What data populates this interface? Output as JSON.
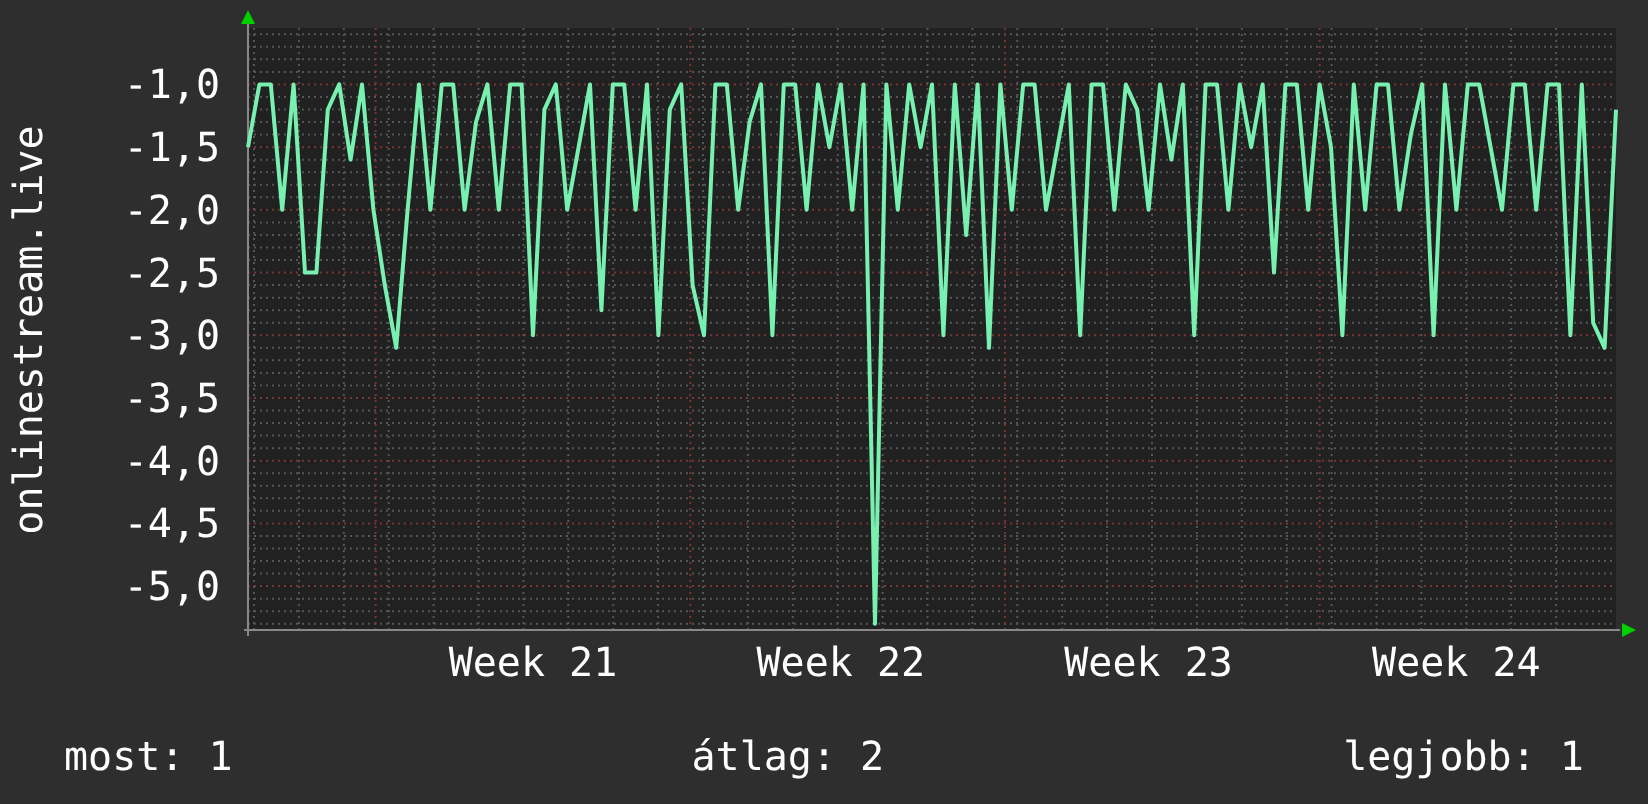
{
  "chart": {
    "chart_data": {
      "type": "line",
      "ylabel": "onlinestream.live",
      "grid": true,
      "ylim": [
        -5.35,
        -0.55
      ],
      "categories": [
        null,
        null,
        null,
        null,
        null,
        null,
        null,
        null,
        null,
        null,
        null,
        null,
        null,
        null,
        null,
        null,
        null,
        null,
        null,
        null,
        null,
        null,
        null,
        null,
        null,
        "Week 21",
        null,
        null,
        null,
        null,
        null,
        null,
        null,
        null,
        null,
        null,
        null,
        null,
        null,
        null,
        null,
        null,
        null,
        null,
        null,
        null,
        null,
        null,
        null,
        null,
        null,
        null,
        "Week 22",
        null,
        null,
        null,
        null,
        null,
        null,
        null,
        null,
        null,
        null,
        null,
        null,
        null,
        null,
        null,
        null,
        null,
        null,
        null,
        null,
        null,
        null,
        null,
        null,
        null,
        null,
        "Week 23",
        null,
        null,
        null,
        null,
        null,
        null,
        null,
        null,
        null,
        null,
        null,
        null,
        null,
        null,
        null,
        null,
        null,
        null,
        null,
        null,
        null,
        null,
        null,
        null,
        null,
        null,
        "Week 24",
        null,
        null,
        null,
        null,
        null,
        null,
        null,
        null,
        null,
        null,
        null,
        null,
        null,
        null
      ],
      "yticks": [
        {
          "value": -1,
          "label": "-1,0"
        },
        {
          "value": -1.5,
          "label": "-1,5"
        },
        {
          "value": -2,
          "label": "-2,0"
        },
        {
          "value": -2.5,
          "label": "-2,5"
        },
        {
          "value": -3,
          "label": "-3,0"
        },
        {
          "value": -3.5,
          "label": "-3,5"
        },
        {
          "value": -4,
          "label": "-4,0"
        },
        {
          "value": -4.5,
          "label": "-4,5"
        },
        {
          "value": -5,
          "label": "-5,0"
        }
      ],
      "series": [
        {
          "color": "#77f0b0",
          "values": [
            -1.5,
            -1.0,
            -1.0,
            -2.0,
            -1.0,
            -2.5,
            -2.5,
            -1.2,
            -1.0,
            -1.6,
            -1.0,
            -2.0,
            -2.6,
            -3.1,
            -2.0,
            -1.0,
            -2.0,
            -1.0,
            -1.0,
            -2.0,
            -1.3,
            -1.0,
            -2.0,
            -1.0,
            -1.0,
            -3.0,
            -1.2,
            -1.0,
            -2.0,
            -1.5,
            -1.0,
            -2.8,
            -1.0,
            -1.0,
            -2.0,
            -1.0,
            -3.0,
            -1.2,
            -1.0,
            -2.6,
            -3.0,
            -1.0,
            -1.0,
            -2.0,
            -1.3,
            -1.0,
            -3.0,
            -1.0,
            -1.0,
            -2.0,
            -1.0,
            -1.5,
            -1.0,
            -2.0,
            -1.0,
            -5.3,
            -1.0,
            -2.0,
            -1.0,
            -1.5,
            -1.0,
            -3.0,
            -1.0,
            -2.2,
            -1.0,
            -3.1,
            -1.0,
            -2.0,
            -1.0,
            -1.0,
            -2.0,
            -1.5,
            -1.0,
            -3.0,
            -1.0,
            -1.0,
            -2.0,
            -1.0,
            -1.2,
            -2.0,
            -1.0,
            -1.6,
            -1.0,
            -3.0,
            -1.0,
            -1.0,
            -2.0,
            -1.0,
            -1.5,
            -1.0,
            -2.5,
            -1.0,
            -1.0,
            -2.0,
            -1.0,
            -1.5,
            -3.0,
            -1.0,
            -2.0,
            -1.0,
            -1.0,
            -2.0,
            -1.4,
            -1.0,
            -3.0,
            -1.0,
            -2.0,
            -1.0,
            -1.0,
            -1.5,
            -2.0,
            -1.0,
            -1.0,
            -2.0,
            -1.0,
            -1.0,
            -3.0,
            -1.0,
            -2.9,
            -3.1,
            -1.2
          ]
        }
      ]
    }
  },
  "legend": [
    "most: 1",
    "átlag: 2",
    "legjobb: 1"
  ]
}
